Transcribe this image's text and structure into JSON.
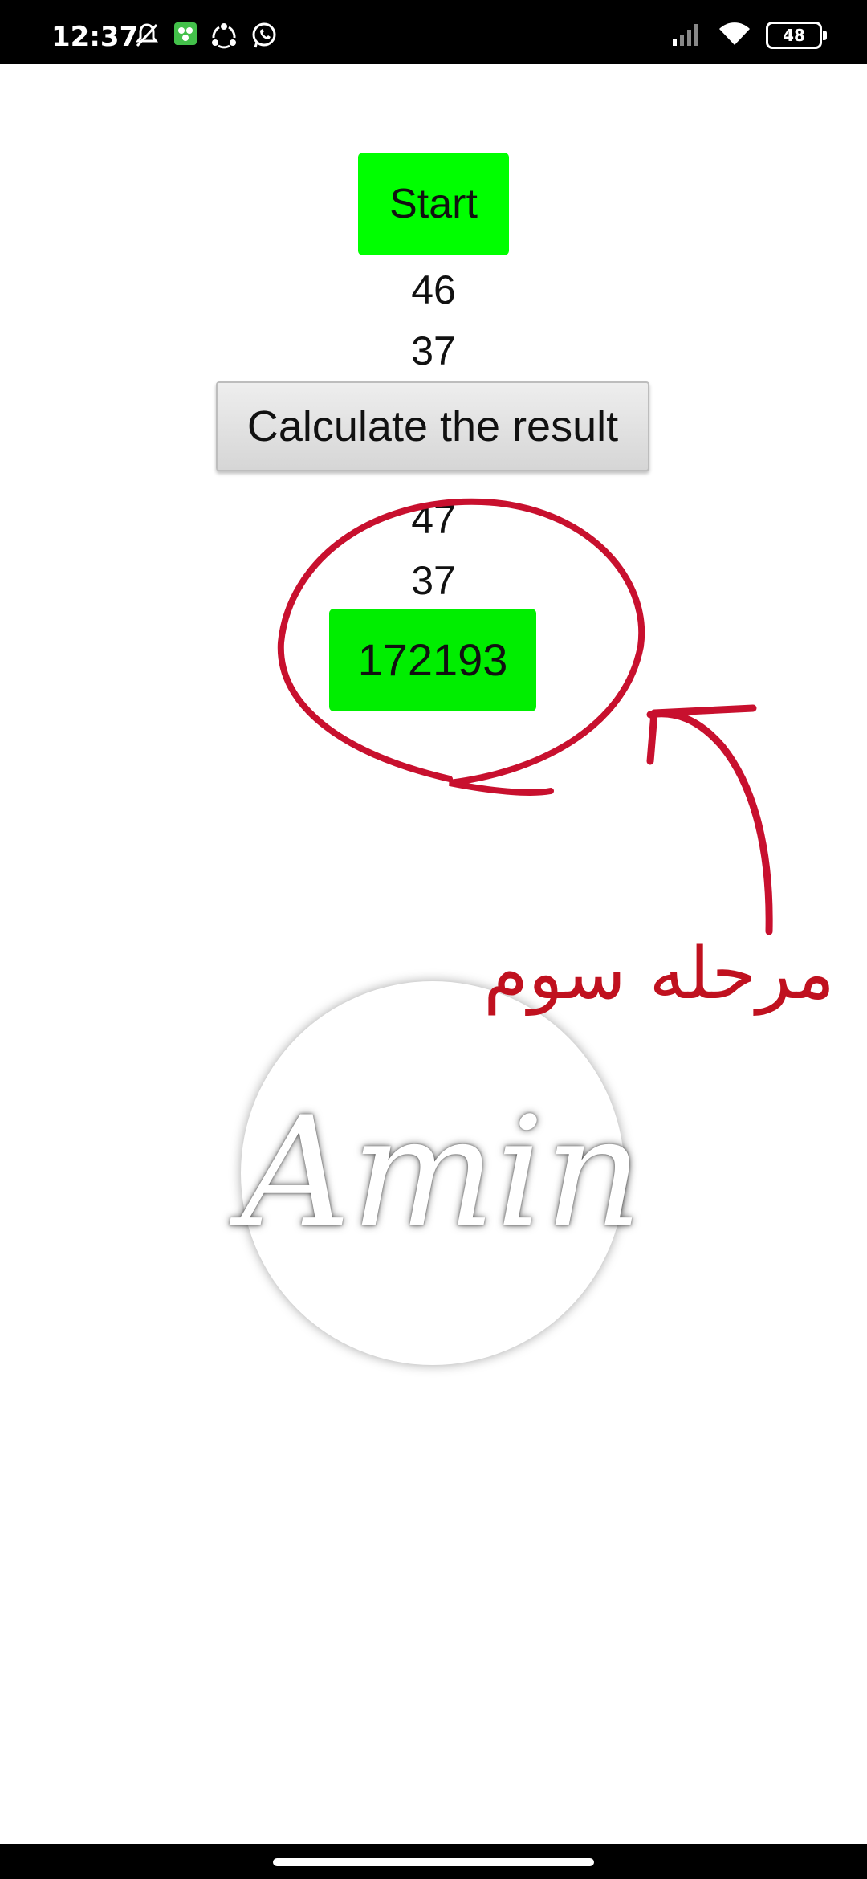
{
  "status_bar": {
    "time": "12:37",
    "battery": "48",
    "left_icons": [
      "mute-icon",
      "game-icon",
      "share-icon",
      "whatsapp-icon"
    ],
    "right_icons": [
      "signal-icon",
      "wifi-icon",
      "battery-icon"
    ]
  },
  "main": {
    "start_label": "Start",
    "number_a": "46",
    "number_b": "37",
    "calculate_label": "Calculate the result",
    "number_c": "47",
    "number_d": "37",
    "result": "172193"
  },
  "annotation": {
    "text": "مرحله سوم",
    "color": "#c0111f"
  },
  "logo": {
    "text": "Amin"
  },
  "colors": {
    "button_green": "#00ff00",
    "status_bar": "#000000"
  }
}
